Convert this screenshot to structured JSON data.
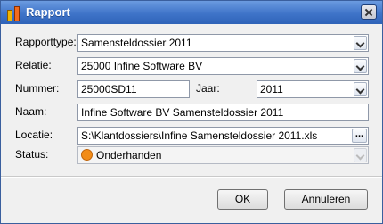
{
  "window": {
    "title": "Rapport"
  },
  "form": {
    "rapporttype": {
      "label": "Rapporttype:",
      "value": "Samensteldossier 2011"
    },
    "relatie": {
      "label": "Relatie:",
      "value": "25000 Infine Software BV"
    },
    "nummer": {
      "label": "Nummer:",
      "value": "25000SD11"
    },
    "jaar": {
      "label": "Jaar:",
      "value": "2011"
    },
    "naam": {
      "label": "Naam:",
      "value": "Infine Software BV Samensteldossier 2011"
    },
    "locatie": {
      "label": "Locatie:",
      "value": "S:\\Klantdossiers\\Infine Samensteldossier 2011.xls",
      "browse_label": "..."
    },
    "status": {
      "label": "Status:",
      "value": "Onderhanden",
      "icon": "orange-circle-icon",
      "icon_color": "#f28c18"
    }
  },
  "buttons": {
    "ok_label": "OK",
    "cancel_label": "Annuleren"
  }
}
